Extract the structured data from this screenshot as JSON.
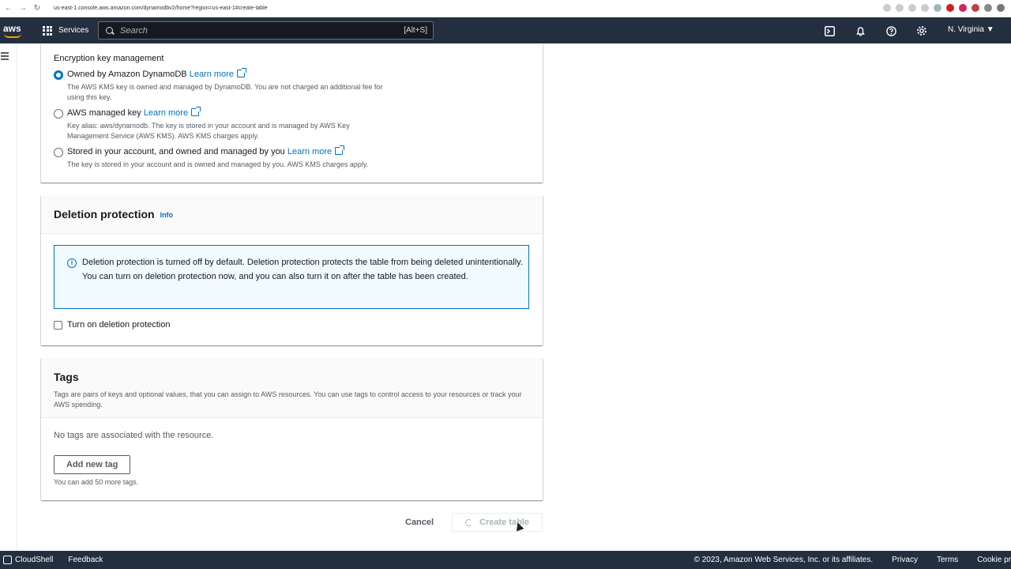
{
  "browser": {
    "url": "us-east-1.console.aws.amazon.com/dynamodbv2/home?region=us-east-1#create-table"
  },
  "topnav": {
    "logo": "aws",
    "services_label": "Services",
    "search_placeholder": "Search",
    "search_shortcut": "[Alt+S]",
    "region": "N. Virginia ▼",
    "icons": [
      "cloudshell-icon",
      "bell-icon",
      "help-icon",
      "gear-icon"
    ]
  },
  "encryption": {
    "heading": "Encryption key management",
    "options": [
      {
        "label": "Owned by Amazon DynamoDB",
        "link": "Learn more",
        "desc1": "The AWS KMS key is owned and managed by DynamoDB. You are not charged an additional fee for",
        "desc2": "using this key.",
        "selected": true
      },
      {
        "label": "AWS managed key",
        "link": "Learn more",
        "desc1": "Key alias: aws/dynamodb. The key is stored in your account and is managed by AWS Key",
        "desc2": "Management Service (AWS KMS). AWS KMS charges apply.",
        "selected": false
      },
      {
        "label": "Stored in your account, and owned and managed by you",
        "link": "Learn more",
        "desc1": "The key is stored in your account and is owned and managed by you. AWS KMS charges apply.",
        "selected": false
      }
    ]
  },
  "deletion": {
    "title": "Deletion protection",
    "info": "Info",
    "alert": "Deletion protection is turned off by default. Deletion protection protects the table from being deleted unintentionally. You can turn on deletion protection now, and you can also turn it on after the table has been created.",
    "checkbox_label": "Turn on deletion protection"
  },
  "tags": {
    "title": "Tags",
    "desc": "Tags are pairs of keys and optional values, that you can assign to AWS resources. You can use tags to control access to your resources or track your AWS spending.",
    "empty": "No tags are associated with the resource.",
    "add_button": "Add new tag",
    "note": "You can add 50 more tags."
  },
  "actions": {
    "cancel": "Cancel",
    "create": "Create table"
  },
  "footer": {
    "cloudshell": "CloudShell",
    "feedback": "Feedback",
    "copyright": "© 2023, Amazon Web Services, Inc. or its affiliates.",
    "privacy": "Privacy",
    "terms": "Terms",
    "cookie": "Cookie pr"
  },
  "colors": {
    "nav_bg": "#232f3e",
    "link": "#0073bb",
    "info_bg": "#f1faff",
    "accent": "#ff9900"
  }
}
